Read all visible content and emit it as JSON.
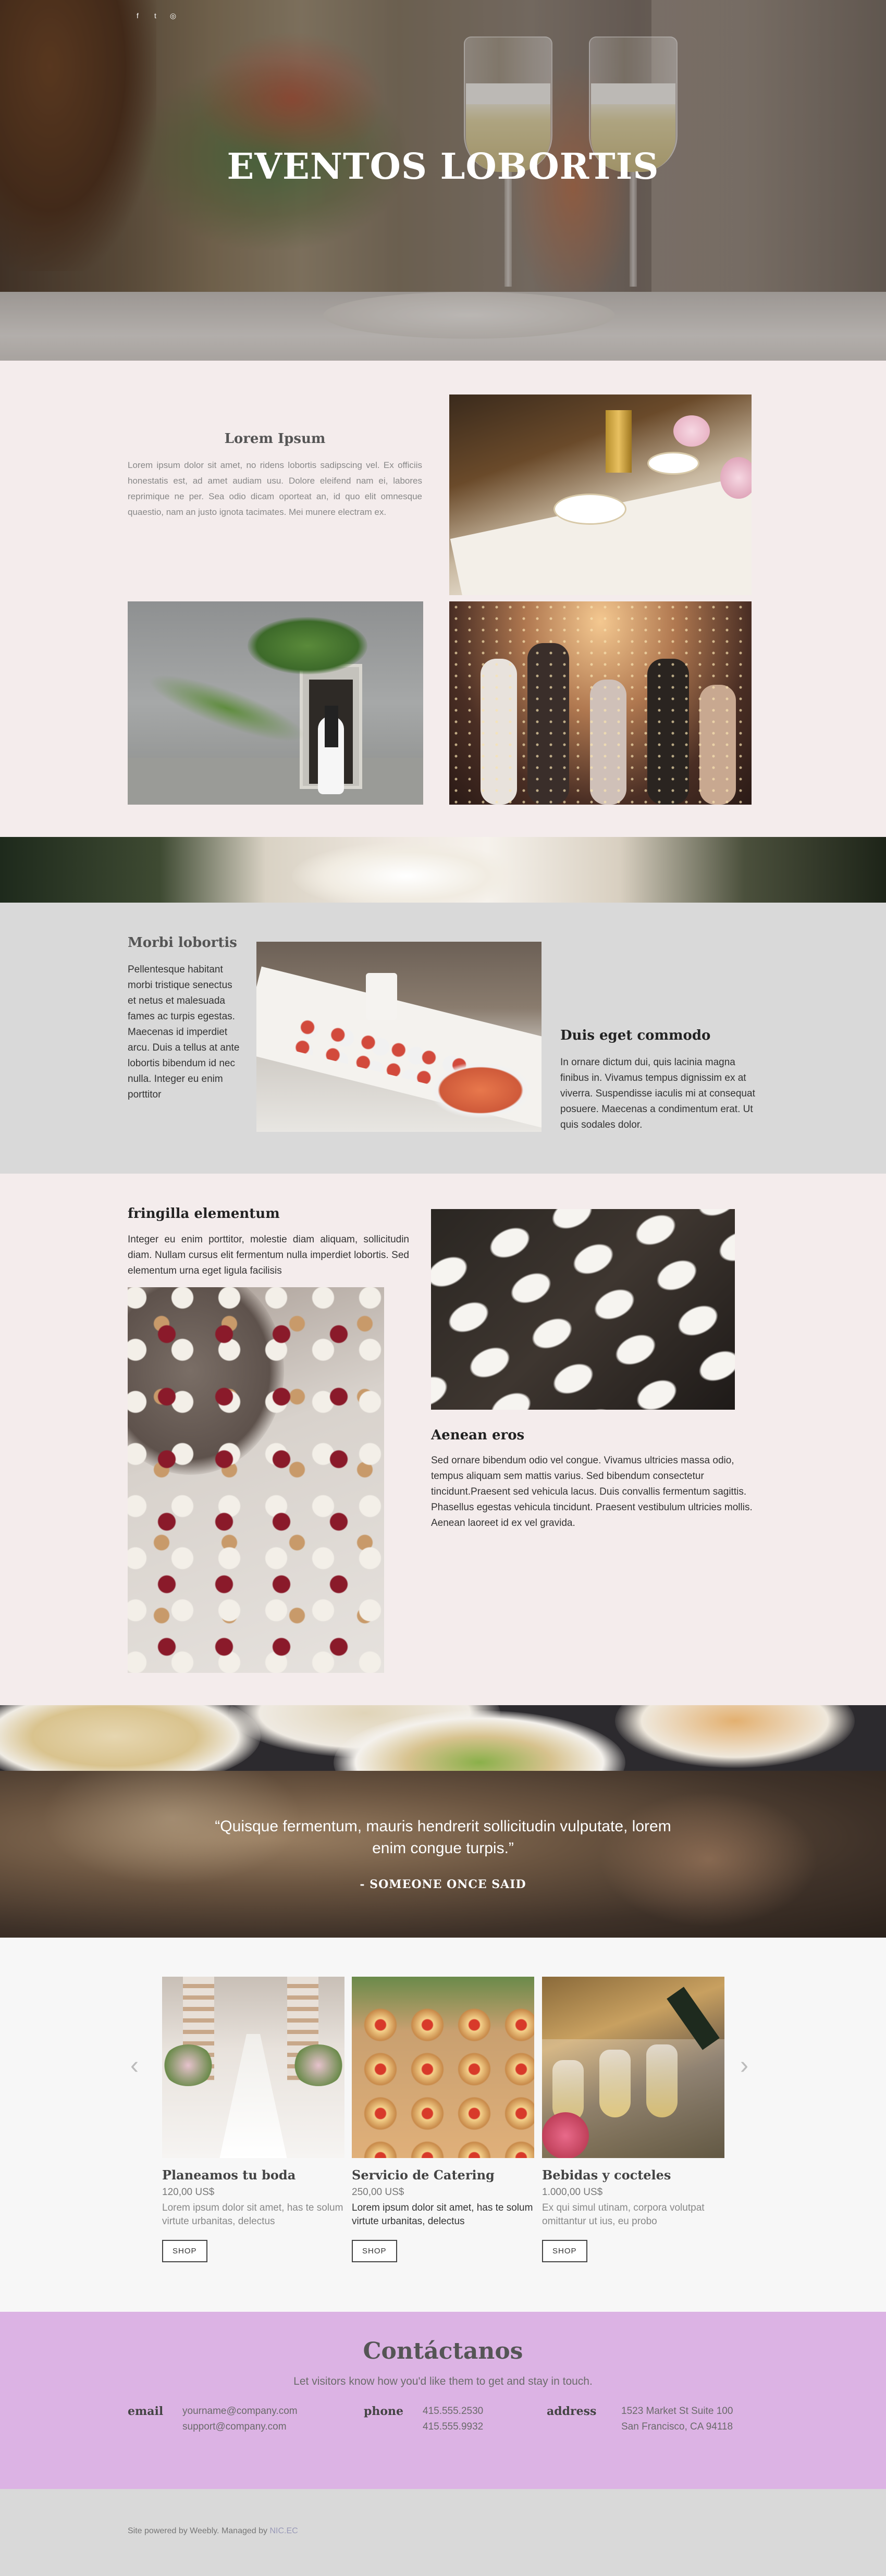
{
  "hero": {
    "title": "EVENTOS LOBORTIS",
    "social": [
      "f",
      "t",
      "◎"
    ]
  },
  "section1": {
    "title": "Lorem Ipsum",
    "text": "Lorem ipsum dolor sit amet, no ridens lobortis sadipscing vel. Ex officiis honestatis est, ad amet audiam usu. Dolore eleifend nam ei, labores reprimique ne per. Sea odio dicam oporteat an, id quo elit omnesque quaestio, nam an justo ignota tacimates. Mei munere electram ex."
  },
  "section2": {
    "left_title": "Morbi lobortis",
    "left_text": "Pellentesque habitant morbi tristique senectus et netus et malesuada fames ac turpis egestas. Maecenas id imperdiet arcu. Duis a tellus at ante lobortis bibendum id nec nulla. Integer eu enim porttitor",
    "right_title": "Duis eget commodo",
    "right_text": "In ornare dictum dui, quis lacinia magna finibus in. Vivamus tempus dignissim ex at viverra. Suspendisse iaculis mi at consequat posuere. Maecenas a condimentum erat. Ut quis sodales dolor."
  },
  "section3": {
    "left_title": "fringilla elementum",
    "left_text": "Integer eu enim porttitor, molestie diam aliquam, sollicitudin diam. Nullam cursus elit fermentum nulla imperdiet lobortis. Sed elementum urna eget ligula facilisis",
    "right_title": "Aenean eros",
    "right_text": "Sed ornare bibendum odio vel congue. Vivamus ultricies massa odio, tempus aliquam sem mattis varius. Sed bibendum consectetur tincidunt.Praesent sed vehicula lacus. Duis convallis fermentum sagittis. Phasellus egestas vehicula tincidunt. Praesent vestibulum ultricies mollis. Aenean laoreet id ex vel gravida."
  },
  "quote": {
    "open_mark": "“",
    "text": "Quisque fermentum, mauris hendrerit sollicitudin vulputate, lorem enim congue turpis.",
    "close_mark": "”",
    "attribution": "- SOMEONE ONCE SAID"
  },
  "products": {
    "prev": "‹",
    "next": "›",
    "items": [
      {
        "name": "Planeamos tu boda",
        "price": "120,00 US$",
        "desc": "Lorem ipsum dolor sit amet, has te solum virtute urbanitas, delectus",
        "button": "SHOP"
      },
      {
        "name": "Servicio de Catering",
        "price": "250,00 US$",
        "desc": "Lorem ipsum dolor sit amet, has te solum virtute urbanitas, delectus",
        "button": "SHOP"
      },
      {
        "name": "Bebidas y cocteles",
        "price": "1.000,00 US$",
        "desc": " Ex qui simul utinam, corpora volutpat omittantur ut ius, eu probo",
        "button": "SHOP"
      }
    ]
  },
  "contact": {
    "title": "Contáctanos",
    "subtitle": "Let visitors know how you'd like them to get and stay in touch.",
    "email_label": "email",
    "email_1": "yourname@company.com",
    "email_2": "support@company.com",
    "phone_label": "phone",
    "phone_1": "415.555.2530",
    "phone_2": "415.555.9932",
    "address_label": "address",
    "address_1": "1523 Market St  Suite 100",
    "address_2": "San Francisco, CA 94118"
  },
  "footer": {
    "prefix": "Site powered by Weebly. Managed by ",
    "link": "NIC.EC"
  },
  "colors": {
    "page_bg": "#f4ecec",
    "gray_section": "#d9d9d9",
    "contact_bg": "#dcb3e4",
    "footer_link": "#9a9ab8"
  }
}
